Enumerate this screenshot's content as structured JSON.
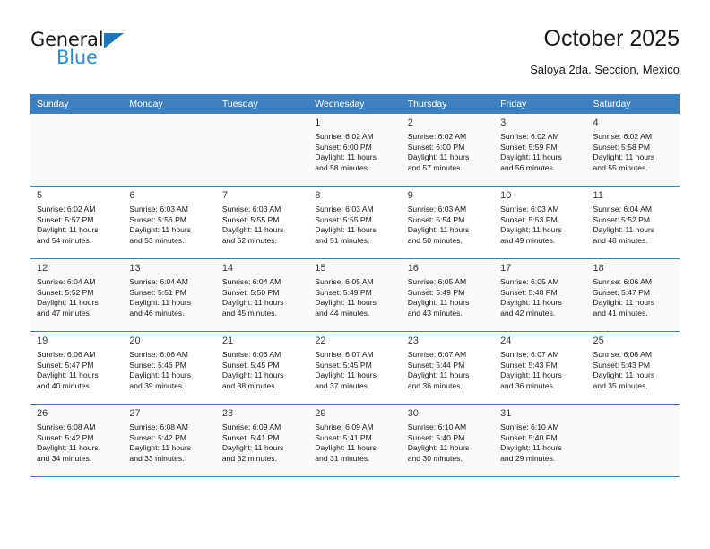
{
  "brand": {
    "name_top": "General",
    "name_bottom": "Blue"
  },
  "header": {
    "title": "October 2025",
    "subtitle": "Saloya 2da. Seccion, Mexico"
  },
  "colors": {
    "header_blue": "#3d7fbf",
    "logo_blue": "#2a8fd4",
    "shaded_row": "#fafafa",
    "text": "#1a1a1a"
  },
  "calendar": {
    "weekdays": [
      "Sunday",
      "Monday",
      "Tuesday",
      "Wednesday",
      "Thursday",
      "Friday",
      "Saturday"
    ],
    "weeks": [
      [
        {
          "day": "",
          "sunrise": "",
          "sunset": "",
          "daylight1": "",
          "daylight2": ""
        },
        {
          "day": "",
          "sunrise": "",
          "sunset": "",
          "daylight1": "",
          "daylight2": ""
        },
        {
          "day": "",
          "sunrise": "",
          "sunset": "",
          "daylight1": "",
          "daylight2": ""
        },
        {
          "day": "1",
          "sunrise": "Sunrise: 6:02 AM",
          "sunset": "Sunset: 6:00 PM",
          "daylight1": "Daylight: 11 hours",
          "daylight2": "and 58 minutes."
        },
        {
          "day": "2",
          "sunrise": "Sunrise: 6:02 AM",
          "sunset": "Sunset: 6:00 PM",
          "daylight1": "Daylight: 11 hours",
          "daylight2": "and 57 minutes."
        },
        {
          "day": "3",
          "sunrise": "Sunrise: 6:02 AM",
          "sunset": "Sunset: 5:59 PM",
          "daylight1": "Daylight: 11 hours",
          "daylight2": "and 56 minutes."
        },
        {
          "day": "4",
          "sunrise": "Sunrise: 6:02 AM",
          "sunset": "Sunset: 5:58 PM",
          "daylight1": "Daylight: 11 hours",
          "daylight2": "and 55 minutes."
        }
      ],
      [
        {
          "day": "5",
          "sunrise": "Sunrise: 6:02 AM",
          "sunset": "Sunset: 5:57 PM",
          "daylight1": "Daylight: 11 hours",
          "daylight2": "and 54 minutes."
        },
        {
          "day": "6",
          "sunrise": "Sunrise: 6:03 AM",
          "sunset": "Sunset: 5:56 PM",
          "daylight1": "Daylight: 11 hours",
          "daylight2": "and 53 minutes."
        },
        {
          "day": "7",
          "sunrise": "Sunrise: 6:03 AM",
          "sunset": "Sunset: 5:55 PM",
          "daylight1": "Daylight: 11 hours",
          "daylight2": "and 52 minutes."
        },
        {
          "day": "8",
          "sunrise": "Sunrise: 6:03 AM",
          "sunset": "Sunset: 5:55 PM",
          "daylight1": "Daylight: 11 hours",
          "daylight2": "and 51 minutes."
        },
        {
          "day": "9",
          "sunrise": "Sunrise: 6:03 AM",
          "sunset": "Sunset: 5:54 PM",
          "daylight1": "Daylight: 11 hours",
          "daylight2": "and 50 minutes."
        },
        {
          "day": "10",
          "sunrise": "Sunrise: 6:03 AM",
          "sunset": "Sunset: 5:53 PM",
          "daylight1": "Daylight: 11 hours",
          "daylight2": "and 49 minutes."
        },
        {
          "day": "11",
          "sunrise": "Sunrise: 6:04 AM",
          "sunset": "Sunset: 5:52 PM",
          "daylight1": "Daylight: 11 hours",
          "daylight2": "and 48 minutes."
        }
      ],
      [
        {
          "day": "12",
          "sunrise": "Sunrise: 6:04 AM",
          "sunset": "Sunset: 5:52 PM",
          "daylight1": "Daylight: 11 hours",
          "daylight2": "and 47 minutes."
        },
        {
          "day": "13",
          "sunrise": "Sunrise: 6:04 AM",
          "sunset": "Sunset: 5:51 PM",
          "daylight1": "Daylight: 11 hours",
          "daylight2": "and 46 minutes."
        },
        {
          "day": "14",
          "sunrise": "Sunrise: 6:04 AM",
          "sunset": "Sunset: 5:50 PM",
          "daylight1": "Daylight: 11 hours",
          "daylight2": "and 45 minutes."
        },
        {
          "day": "15",
          "sunrise": "Sunrise: 6:05 AM",
          "sunset": "Sunset: 5:49 PM",
          "daylight1": "Daylight: 11 hours",
          "daylight2": "and 44 minutes."
        },
        {
          "day": "16",
          "sunrise": "Sunrise: 6:05 AM",
          "sunset": "Sunset: 5:49 PM",
          "daylight1": "Daylight: 11 hours",
          "daylight2": "and 43 minutes."
        },
        {
          "day": "17",
          "sunrise": "Sunrise: 6:05 AM",
          "sunset": "Sunset: 5:48 PM",
          "daylight1": "Daylight: 11 hours",
          "daylight2": "and 42 minutes."
        },
        {
          "day": "18",
          "sunrise": "Sunrise: 6:06 AM",
          "sunset": "Sunset: 5:47 PM",
          "daylight1": "Daylight: 11 hours",
          "daylight2": "and 41 minutes."
        }
      ],
      [
        {
          "day": "19",
          "sunrise": "Sunrise: 6:06 AM",
          "sunset": "Sunset: 5:47 PM",
          "daylight1": "Daylight: 11 hours",
          "daylight2": "and 40 minutes."
        },
        {
          "day": "20",
          "sunrise": "Sunrise: 6:06 AM",
          "sunset": "Sunset: 5:46 PM",
          "daylight1": "Daylight: 11 hours",
          "daylight2": "and 39 minutes."
        },
        {
          "day": "21",
          "sunrise": "Sunrise: 6:06 AM",
          "sunset": "Sunset: 5:45 PM",
          "daylight1": "Daylight: 11 hours",
          "daylight2": "and 38 minutes."
        },
        {
          "day": "22",
          "sunrise": "Sunrise: 6:07 AM",
          "sunset": "Sunset: 5:45 PM",
          "daylight1": "Daylight: 11 hours",
          "daylight2": "and 37 minutes."
        },
        {
          "day": "23",
          "sunrise": "Sunrise: 6:07 AM",
          "sunset": "Sunset: 5:44 PM",
          "daylight1": "Daylight: 11 hours",
          "daylight2": "and 36 minutes."
        },
        {
          "day": "24",
          "sunrise": "Sunrise: 6:07 AM",
          "sunset": "Sunset: 5:43 PM",
          "daylight1": "Daylight: 11 hours",
          "daylight2": "and 36 minutes."
        },
        {
          "day": "25",
          "sunrise": "Sunrise: 6:08 AM",
          "sunset": "Sunset: 5:43 PM",
          "daylight1": "Daylight: 11 hours",
          "daylight2": "and 35 minutes."
        }
      ],
      [
        {
          "day": "26",
          "sunrise": "Sunrise: 6:08 AM",
          "sunset": "Sunset: 5:42 PM",
          "daylight1": "Daylight: 11 hours",
          "daylight2": "and 34 minutes."
        },
        {
          "day": "27",
          "sunrise": "Sunrise: 6:08 AM",
          "sunset": "Sunset: 5:42 PM",
          "daylight1": "Daylight: 11 hours",
          "daylight2": "and 33 minutes."
        },
        {
          "day": "28",
          "sunrise": "Sunrise: 6:09 AM",
          "sunset": "Sunset: 5:41 PM",
          "daylight1": "Daylight: 11 hours",
          "daylight2": "and 32 minutes."
        },
        {
          "day": "29",
          "sunrise": "Sunrise: 6:09 AM",
          "sunset": "Sunset: 5:41 PM",
          "daylight1": "Daylight: 11 hours",
          "daylight2": "and 31 minutes."
        },
        {
          "day": "30",
          "sunrise": "Sunrise: 6:10 AM",
          "sunset": "Sunset: 5:40 PM",
          "daylight1": "Daylight: 11 hours",
          "daylight2": "and 30 minutes."
        },
        {
          "day": "31",
          "sunrise": "Sunrise: 6:10 AM",
          "sunset": "Sunset: 5:40 PM",
          "daylight1": "Daylight: 11 hours",
          "daylight2": "and 29 minutes."
        },
        {
          "day": "",
          "sunrise": "",
          "sunset": "",
          "daylight1": "",
          "daylight2": ""
        }
      ]
    ]
  }
}
